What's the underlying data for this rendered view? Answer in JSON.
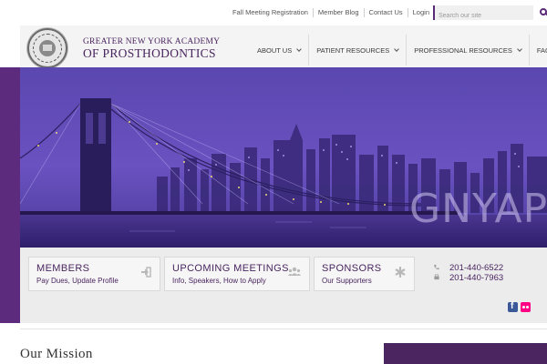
{
  "topbar": {
    "links": [
      "Fall Meeting Registration",
      "Member Blog",
      "Contact Us",
      "Login"
    ],
    "search_placeholder": "Search our site"
  },
  "header": {
    "brand_line1": "GREATER NEW YORK ACADEMY",
    "brand_line2": "OF PROSTHODONTICS",
    "nav": [
      {
        "label": "ABOUT US",
        "dropdown": true
      },
      {
        "label": "PATIENT RESOURCES",
        "dropdown": true
      },
      {
        "label": "PROFESSIONAL RESOURCES",
        "dropdown": true
      },
      {
        "label": "FAQS",
        "dropdown": false
      }
    ]
  },
  "hero": {
    "overlay_text": "GNYAP"
  },
  "cards": [
    {
      "title": "MEMBERS",
      "subtitle": "Pay Dues, Update Profile",
      "icon": "sign-in-icon"
    },
    {
      "title": "UPCOMING  MEETINGS",
      "subtitle": "Info, Speakers, How to Apply",
      "icon": "users-icon"
    },
    {
      "title": "SPONSORS",
      "subtitle": "Our Supporters",
      "icon": "asterisk-icon"
    }
  ],
  "contact": {
    "phone": "201-440-6522",
    "fax": "201-440-7963"
  },
  "social": [
    "facebook-icon",
    "flickr-icon"
  ],
  "mission": {
    "heading": "Our Mission"
  },
  "colors": {
    "brand_purple": "#4a2560",
    "band_purple": "#5c2b7d",
    "strip_gray": "#ececec"
  }
}
